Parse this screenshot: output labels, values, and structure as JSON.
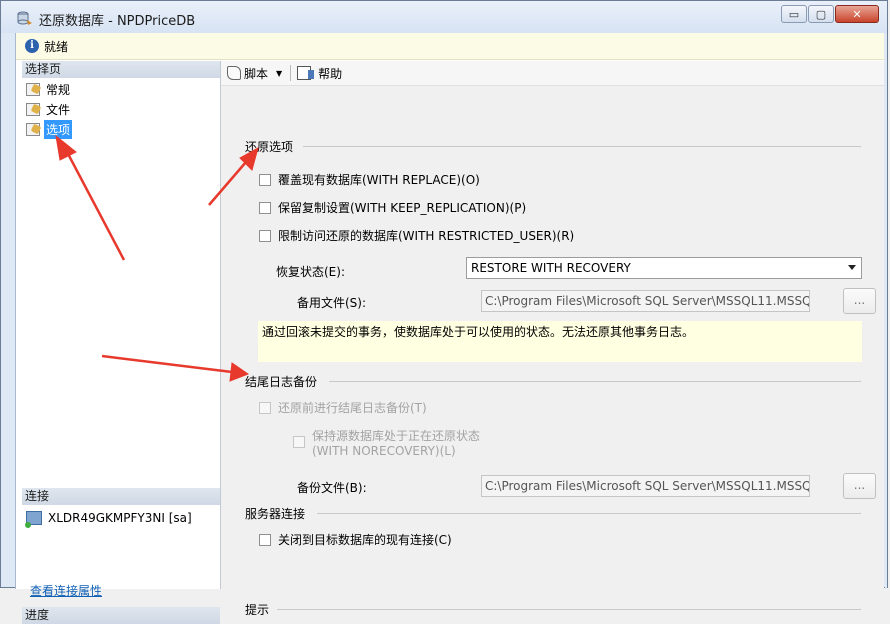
{
  "window": {
    "title": "还原数据库 - NPDPriceDB",
    "buttons": {
      "minimize": "▭",
      "maximize": "▢",
      "close": "✕"
    }
  },
  "status": {
    "text": "就绪",
    "icon": "info-icon"
  },
  "left": {
    "select_page_header": "选择页",
    "pages": [
      {
        "label": "常规",
        "selected": false
      },
      {
        "label": "文件",
        "selected": false
      },
      {
        "label": "选项",
        "selected": true
      }
    ],
    "connection_header": "连接",
    "connection_server": "XLDR49GKMPFY3NI [sa]",
    "view_connection_properties": "查看连接属性",
    "progress_header": "进度"
  },
  "toolbar": {
    "script_label": "脚本",
    "help_label": "帮助"
  },
  "restore_options": {
    "title": "还原选项",
    "options": [
      {
        "label": "覆盖现有数据库(WITH REPLACE)(O)",
        "checked": false
      },
      {
        "label": "保留复制设置(WITH KEEP_REPLICATION)(P)",
        "checked": false
      },
      {
        "label": "限制访问还原的数据库(WITH RESTRICTED_USER)(R)",
        "checked": false
      }
    ],
    "recovery_state_label": "恢复状态(E):",
    "recovery_state_value": "RESTORE WITH RECOVERY",
    "standby_file_label": "备用文件(S):",
    "standby_file_value": "C:\\Program Files\\Microsoft SQL Server\\MSSQL11.MSSQ",
    "description": "通过回滚未提交的事务，使数据库处于可以使用的状态。无法还原其他事务日志。"
  },
  "tail_log": {
    "title": "结尾日志备份",
    "take_backup_label": "还原前进行结尾日志备份(T)",
    "norecovery_line1": "保持源数据库处于正在还原状态",
    "norecovery_line2": "(WITH NORECOVERY)(L)",
    "backup_file_label": "备份文件(B):",
    "backup_file_value": "C:\\Program Files\\Microsoft SQL Server\\MSSQL11.MSSQ"
  },
  "server_connections": {
    "title": "服务器连接",
    "close_connections_label": "关闭到目标数据库的现有连接(C)"
  },
  "prompt": {
    "title": "提示"
  },
  "browse_label": "...",
  "colors": {
    "annotation_arrow": "#e8392d",
    "selection": "#3399ff",
    "description_bg": "#ffffe1"
  }
}
